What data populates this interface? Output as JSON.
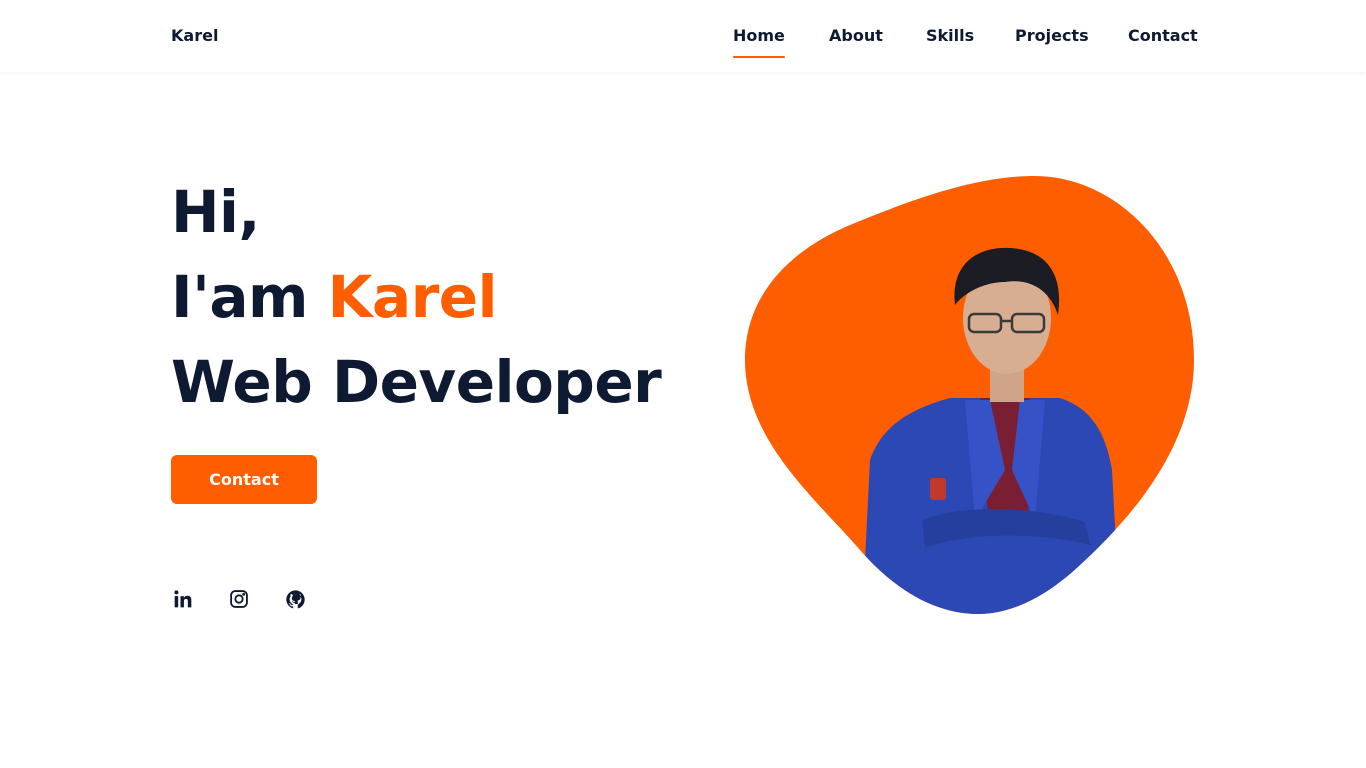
{
  "header": {
    "logo": "Karel",
    "nav": [
      {
        "label": "Home",
        "active": true
      },
      {
        "label": "About",
        "active": false
      },
      {
        "label": "Skills",
        "active": false
      },
      {
        "label": "Projects",
        "active": false
      },
      {
        "label": "Contact",
        "active": false
      }
    ]
  },
  "hero": {
    "greeting": "Hi,",
    "intro_prefix": "I'am ",
    "name": "Karel",
    "role": "Web Developer",
    "contact_button": "Contact"
  },
  "social": {
    "icons": [
      "linkedin-icon",
      "instagram-icon",
      "github-icon"
    ]
  },
  "colors": {
    "accent": "#ff5e00",
    "text_dark": "#0e1a32",
    "background": "#ffffff",
    "blazer_blue": "#2c48b5"
  }
}
